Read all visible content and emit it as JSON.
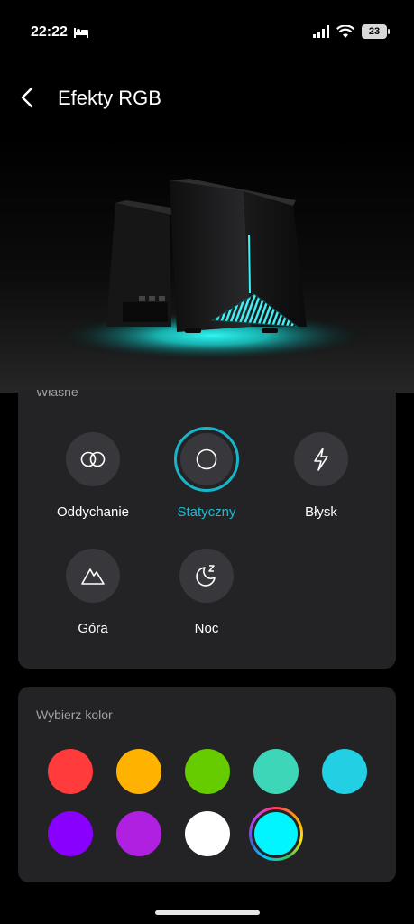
{
  "status_bar": {
    "time": "22:22",
    "battery": "23"
  },
  "header": {
    "title": "Efekty RGB"
  },
  "effects": {
    "section_label": "Własne",
    "items": [
      {
        "label": "Oddychanie",
        "icon": "two-rings-icon",
        "active": false
      },
      {
        "label": "Statyczny",
        "icon": "circle-icon",
        "active": true
      },
      {
        "label": "Błysk",
        "icon": "lightning-icon",
        "active": false
      },
      {
        "label": "Góra",
        "icon": "mountain-icon",
        "active": false
      },
      {
        "label": "Noc",
        "icon": "moon-icon",
        "active": false
      }
    ]
  },
  "colors": {
    "section_label": "Wybierz kolor",
    "swatches": [
      "#ff3b3b",
      "#ffb300",
      "#66cc00",
      "#3ed6b8",
      "#22cfe3",
      "#8a00ff",
      "#b020e0",
      "#ffffff",
      "#00f5ff"
    ],
    "selected": "#00f5ff"
  },
  "accent": "#22b8d0"
}
